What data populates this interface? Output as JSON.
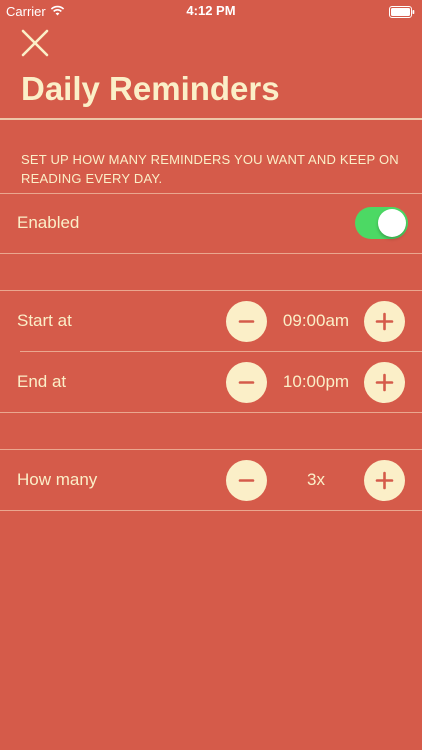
{
  "status_bar": {
    "carrier": "Carrier",
    "time": "4:12 PM",
    "icons": [
      "wifi-icon",
      "battery-icon"
    ]
  },
  "header": {
    "close_icon": "close-icon",
    "title": "Daily Reminders"
  },
  "intro": "SET UP HOW MANY REMINDERS YOU WANT AND KEEP ON READING EVERY DAY.",
  "enabled": {
    "label": "Enabled",
    "on": true
  },
  "start": {
    "label": "Start at",
    "value": "09:00am"
  },
  "end": {
    "label": "End at",
    "value": "10:00pm"
  },
  "count": {
    "label": "How many",
    "value": "3x"
  },
  "stepper_icons": {
    "decrement": "minus-icon",
    "increment": "plus-icon"
  },
  "colors": {
    "background": "#d55b4a",
    "text": "#fbefc8",
    "button_fill": "#fbefc8",
    "button_glyph": "#d55b4a",
    "toggle_on": "#4cd964"
  }
}
